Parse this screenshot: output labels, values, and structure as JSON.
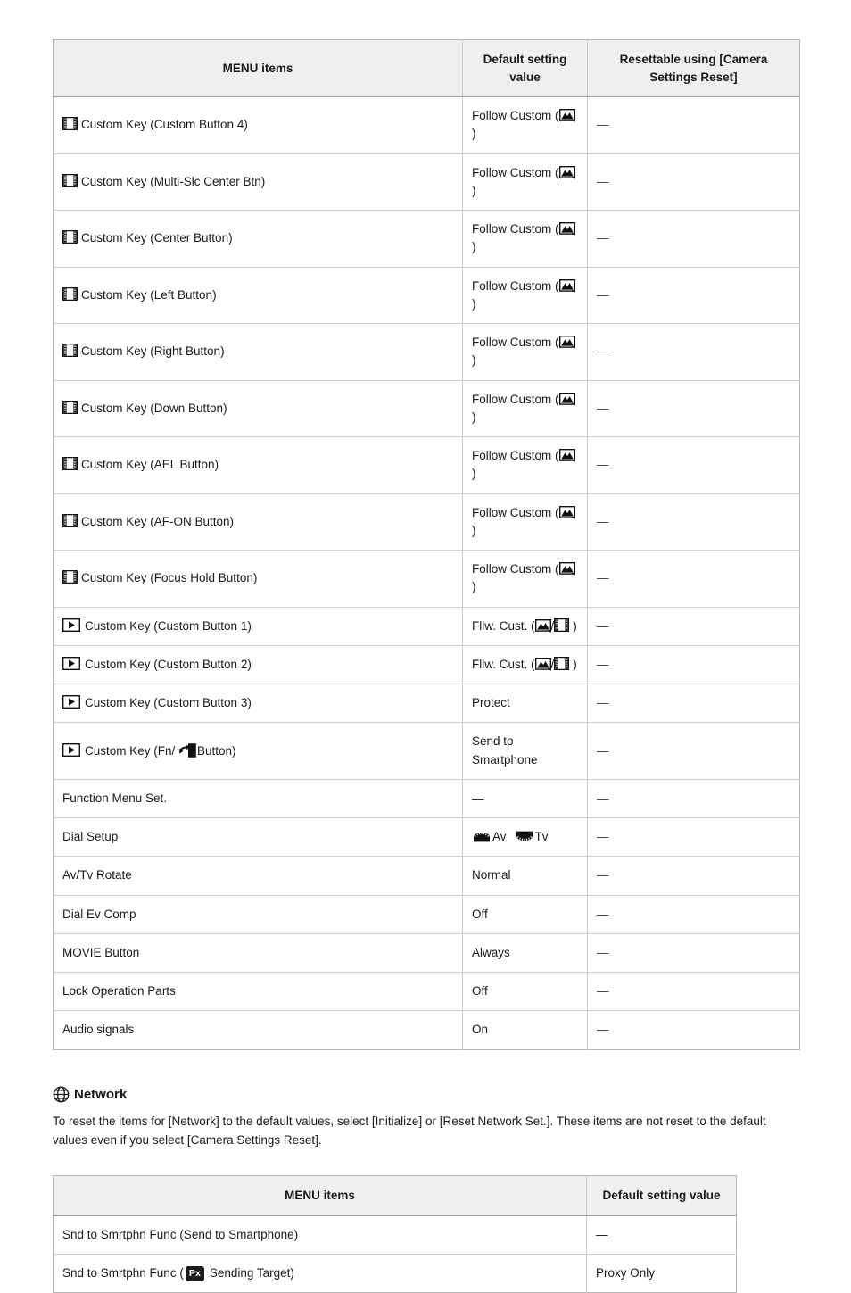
{
  "main_table": {
    "headers": [
      "MENU items",
      "Default setting value",
      "Resettable using [Camera Settings Reset]"
    ],
    "rows": [
      {
        "icon": "movie-icon",
        "label": "Custom Key (Custom Button 4)",
        "default": "Follow Custom (",
        "default_icon": "still-image-icon",
        "default_suffix": ")",
        "reset": "—"
      },
      {
        "icon": "movie-icon",
        "label": "Custom Key (Multi-Slc Center Btn)",
        "default": "Follow Custom (",
        "default_icon": "still-image-icon",
        "default_suffix": ")",
        "reset": "—"
      },
      {
        "icon": "movie-icon",
        "label": "Custom Key (Center Button)",
        "default": "Follow Custom (",
        "default_icon": "still-image-icon",
        "default_suffix": ")",
        "reset": "—"
      },
      {
        "icon": "movie-icon",
        "label": "Custom Key (Left Button)",
        "default": "Follow Custom (",
        "default_icon": "still-image-icon",
        "default_suffix": ")",
        "reset": "—"
      },
      {
        "icon": "movie-icon",
        "label": "Custom Key (Right Button)",
        "default": "Follow Custom (",
        "default_icon": "still-image-icon",
        "default_suffix": ")",
        "reset": "—"
      },
      {
        "icon": "movie-icon",
        "label": "Custom Key (Down Button)",
        "default": "Follow Custom (",
        "default_icon": "still-image-icon",
        "default_suffix": ")",
        "reset": "—"
      },
      {
        "icon": "movie-icon",
        "label": "Custom Key (AEL Button)",
        "default": "Follow Custom (",
        "default_icon": "still-image-icon",
        "default_suffix": ")",
        "reset": "—"
      },
      {
        "icon": "movie-icon",
        "label": "Custom Key (AF-ON Button)",
        "default": "Follow Custom (",
        "default_icon": "still-image-icon",
        "default_suffix": ")",
        "reset": "—"
      },
      {
        "icon": "movie-icon",
        "label": "Custom Key (Focus Hold Button)",
        "default": "Follow Custom (",
        "default_icon": "still-image-icon",
        "default_suffix": ")",
        "reset": "—"
      },
      {
        "icon": "playback-icon",
        "label": "Custom Key (Custom Button 1)",
        "default": "Fllw. Cust. (",
        "default_icon": "still-image-icon",
        "default_mid": "/",
        "default_icon2": "movie-icon",
        "default_suffix": ")",
        "reset": "—"
      },
      {
        "icon": "playback-icon",
        "label": "Custom Key (Custom Button 2)",
        "default": "Fllw. Cust. (",
        "default_icon": "still-image-icon",
        "default_mid": "/",
        "default_icon2": "movie-icon",
        "default_suffix": ")",
        "reset": "—"
      },
      {
        "icon": "playback-icon",
        "label": "Custom Key (Custom Button 3)",
        "default": "Protect",
        "reset": "—"
      },
      {
        "icon": "playback-icon",
        "label_pre": "Custom Key (Fn/ ",
        "label_icon": "send-to-smartphone-icon",
        "label_post": "Button)",
        "default": "Send to Smartphone",
        "reset": "—"
      },
      {
        "label": "Function Menu Set.",
        "default": "—",
        "reset": "—"
      },
      {
        "label": "Dial Setup",
        "default_dials": {
          "front_icon": "front-dial-icon",
          "front_label": "Av",
          "rear_icon": "rear-dial-icon",
          "rear_label": "Tv"
        },
        "reset": "—"
      },
      {
        "label": "Av/Tv Rotate",
        "default": "Normal",
        "reset": "—"
      },
      {
        "label": "Dial Ev Comp",
        "default": "Off",
        "reset": "—"
      },
      {
        "label": "MOVIE Button",
        "default": "Always",
        "reset": "—"
      },
      {
        "label": "Lock Operation Parts",
        "default": "Off",
        "reset": "—"
      },
      {
        "label": "Audio signals",
        "default": "On",
        "reset": "—"
      }
    ]
  },
  "network_section": {
    "icon": "globe-icon",
    "title": "Network",
    "body": "To reset the items for [Network] to the default values, select [Initialize] or [Reset Network Set.]. These items are not reset to the default values even if you select [Camera Settings Reset]."
  },
  "network_table": {
    "headers": [
      "MENU items",
      "Default setting value"
    ],
    "rows": [
      {
        "label": "Snd to Smrtphn Func (Send to Smartphone)",
        "default": "—"
      },
      {
        "label_pre": "Snd to Smrtphn Func (",
        "badge": "Px",
        "label_post": " Sending Target)",
        "default": "Proxy Only"
      }
    ]
  },
  "colors": {
    "header_bg": "#efefef",
    "border": "#c9c9c9",
    "text": "#1a1a1a",
    "badge_bg": "#1b1b1b"
  }
}
